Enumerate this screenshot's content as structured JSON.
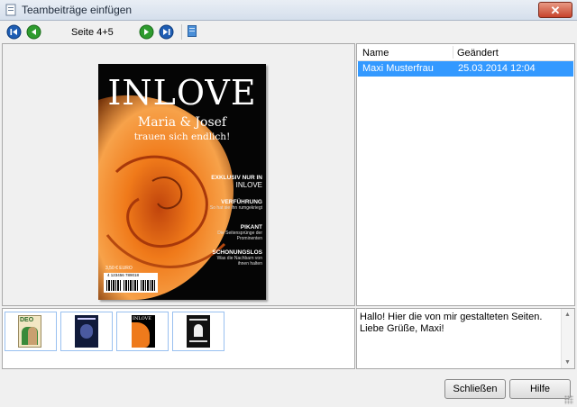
{
  "window": {
    "title": "Teambeiträge einfügen",
    "close_glyph": "✕",
    "icon": "app-icon"
  },
  "toolbar": {
    "page_label": "Seite 4+5",
    "icons": [
      "first-page-icon",
      "previous-page-icon",
      "next-page-icon",
      "last-page-icon",
      "document-icon"
    ]
  },
  "cover": {
    "title": "INLOVE",
    "subtitle": "Maria & Josef",
    "tagline": "trauen sich endlich!",
    "features": [
      {
        "head": "EXKLUSIV NUR IN",
        "line": "INLOVE"
      },
      {
        "head": "VERFÜHRUNG",
        "line": "So hat sie ihn rumgekriegt"
      },
      {
        "head": "PIKANT",
        "line": "Die Seitensprünge der Prominenten"
      },
      {
        "head": "SCHONUNGSLOS",
        "line": "Was die Nachbarn von ihnen halten"
      }
    ],
    "price": "3,50 € EURO",
    "barcode_text": "4 123456 789018"
  },
  "list": {
    "columns": [
      "Name",
      "Geändert"
    ],
    "rows": [
      {
        "name": "Maxi Musterfrau",
        "changed": "25.03.2014 12:04",
        "selected": true
      }
    ]
  },
  "comment": {
    "text": "Hallo! Hier die von mir gestalteten Seiten. Liebe Grüße, Maxi!"
  },
  "thumbnails": [
    {
      "label": "DEO"
    },
    {
      "label": ""
    },
    {
      "label": "INLOVE"
    },
    {
      "label": ""
    }
  ],
  "buttons": {
    "close": "Schließen",
    "help": "Hilfe"
  },
  "colors": {
    "selection": "#3399ff",
    "rose": "#f07a1a"
  }
}
